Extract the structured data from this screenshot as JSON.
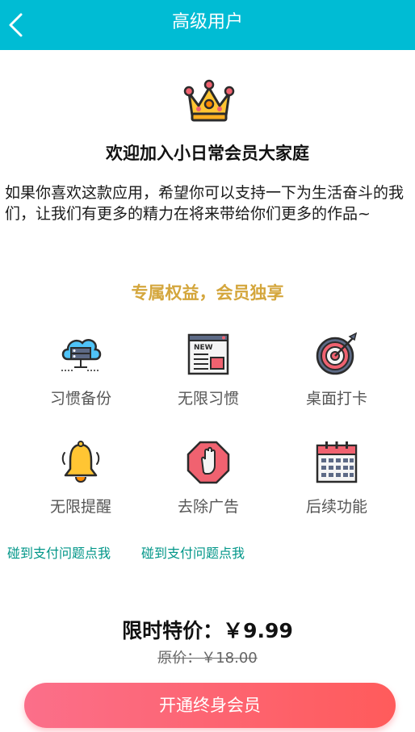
{
  "header": {
    "title": "高级用户",
    "back_icon": "chevron-left-icon",
    "bg_color": "#00bcd4"
  },
  "hero": {
    "icon": "crown-icon",
    "headline": "欢迎加入小日常会员大家庭",
    "intro": "如果你喜欢这款应用，希望你可以支持一下为生活奋斗的我们，让我们有更多的精力在将来带给你们更多的作品~"
  },
  "benefits": {
    "title": "专属权益，会员独享",
    "title_color": "#d4a63c",
    "items": [
      {
        "label": "习惯备份",
        "icon": "cloud-backup-icon"
      },
      {
        "label": "无限习惯",
        "icon": "news-icon"
      },
      {
        "label": "桌面打卡",
        "icon": "target-icon"
      },
      {
        "label": "无限提醒",
        "icon": "bell-icon"
      },
      {
        "label": "去除广告",
        "icon": "stop-hand-icon"
      },
      {
        "label": "后续功能",
        "icon": "calendar-icon"
      }
    ]
  },
  "help_links": [
    "碰到支付问题点我",
    "碰到支付问题点我"
  ],
  "pricing": {
    "current": "限时特价：￥9.99",
    "original": "原价：￥18.00"
  },
  "cta": {
    "label": "开通终身会员",
    "color": "#ff5b6b"
  }
}
